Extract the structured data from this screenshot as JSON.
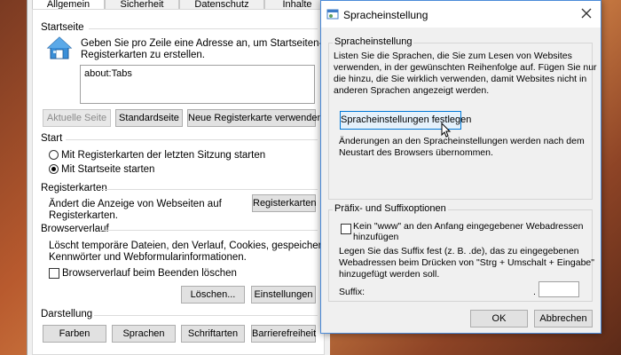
{
  "internet_options": {
    "tabs": [
      "Allgemein",
      "Sicherheit",
      "Datenschutz",
      "Inhalte"
    ],
    "homepage": {
      "title": "Startseite",
      "description_line1": "Geben Sie pro Zeile eine Adresse an, um Startseiten-",
      "description_line2": "Registerkarten zu erstellen.",
      "value": "about:Tabs",
      "btn_current": "Aktuelle Seite",
      "btn_default": "Standardseite",
      "btn_new_tab": "Neue Registerkarte verwenden"
    },
    "start": {
      "title": "Start",
      "option_last_session": "Mit Registerkarten der letzten Sitzung starten",
      "option_homepage": "Mit Startseite starten",
      "selected": "homepage"
    },
    "tabs_section": {
      "title": "Registerkarten",
      "description_line1": "Ändert die Anzeige von Webseiten auf",
      "description_line2": "Registerkarten.",
      "btn": "Registerkarten"
    },
    "history": {
      "title": "Browserverlauf",
      "description_line1": "Löscht temporäre Dateien, den Verlauf, Cookies, gespeicherte",
      "description_line2": "Kennwörter und Webformularinformationen.",
      "checkbox_label": "Browserverlauf beim Beenden löschen",
      "btn_delete": "Löschen...",
      "btn_settings": "Einstellungen"
    },
    "appearance": {
      "title": "Darstellung",
      "btn_colors": "Farben",
      "btn_languages": "Sprachen",
      "btn_fonts": "Schriftarten",
      "btn_accessibility": "Barrierefreiheit"
    }
  },
  "dialog": {
    "title": "Spracheinstellung",
    "close_icon": "close-icon",
    "group1": {
      "title": "Spracheinstellung",
      "text_line1": "Listen Sie die Sprachen, die Sie zum Lesen von Websites",
      "text_line2": "verwenden, in der gewünschten Reihenfolge auf. Fügen Sie nur",
      "text_line3": "die hinzu, die Sie wirklich verwenden, damit Websites nicht in",
      "text_line4": "anderen Sprachen angezeigt werden.",
      "btn": "Spracheinstellungen festlegen",
      "note_line1": "Änderungen an den Spracheinstellungen werden nach dem",
      "note_line2": "Neustart des Browsers übernommen."
    },
    "group2": {
      "title": "Präfix- und Suffixoptionen",
      "checkbox_line1": "Kein \"www\" an den Anfang eingegebener Webadressen",
      "checkbox_line2": "hinzufügen",
      "text_line1": "Legen Sie das Suffix fest (z. B. .de), das zu eingegebenen",
      "text_line2": "Webadressen beim Drücken von \"Strg + Umschalt + Eingabe\"",
      "text_line3": "hinzugefügt werden soll.",
      "suffix_label": "Suffix:",
      "suffix_dot": ".",
      "suffix_value": ""
    },
    "btn_ok": "OK",
    "btn_cancel": "Abbrechen"
  }
}
